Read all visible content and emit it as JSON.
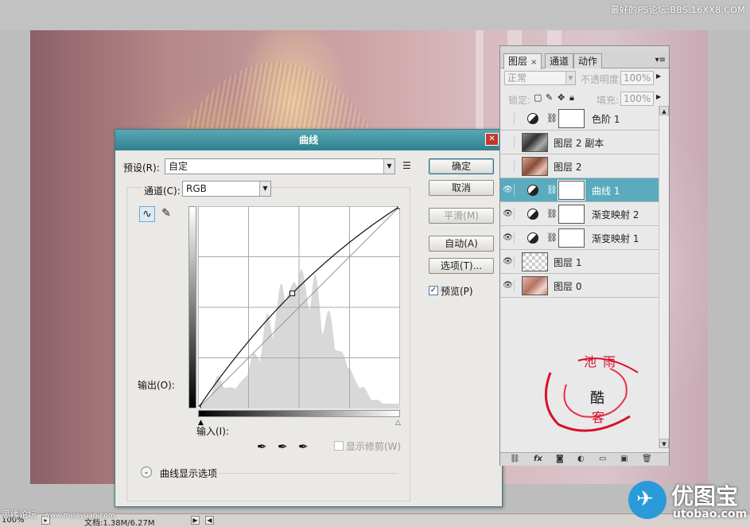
{
  "watermark_top": "最好的PS论坛:BBS.16XX8.COM",
  "watermark_bottom": "思缘论坛",
  "watermark_bottom_url": "www.missyuan.com",
  "statusbar": {
    "zoom": "100%",
    "doc": "文档:1.38M/6.27M"
  },
  "curves_dialog": {
    "title": "曲线",
    "preset_label": "预设(R):",
    "preset_value": "自定",
    "channel_label": "通道(C):",
    "channel_value": "RGB",
    "output_label": "输出(O):",
    "input_label": "输入(I):",
    "show_clipping_label": "显示修剪(W)",
    "display_options_label": "曲线显示选项",
    "buttons": {
      "ok": "确定",
      "cancel": "取消",
      "smooth": "平滑(M)",
      "auto": "自动(A)",
      "options": "选项(T)..."
    },
    "preview_label": "预览(P)",
    "preview_checked": true
  },
  "layers_panel": {
    "tabs": [
      "图层",
      "通道",
      "动作"
    ],
    "blend_mode": "正常",
    "opacity_label": "不透明度:",
    "opacity_value": "100%",
    "lock_label": "锁定:",
    "fill_label": "填充:",
    "fill_value": "100%",
    "layers": [
      {
        "name": "色阶 1",
        "visible": false,
        "type": "adjustment",
        "selected": false
      },
      {
        "name": "图层 2 副本",
        "visible": false,
        "type": "image",
        "selected": false
      },
      {
        "name": "图层 2",
        "visible": false,
        "type": "image",
        "selected": false
      },
      {
        "name": "曲线 1",
        "visible": true,
        "type": "adjustment",
        "selected": true
      },
      {
        "name": "渐变映射 2",
        "visible": true,
        "type": "adjustment",
        "selected": false
      },
      {
        "name": "渐变映射 1",
        "visible": true,
        "type": "adjustment",
        "selected": false
      },
      {
        "name": "图层 1",
        "visible": true,
        "type": "transparent",
        "selected": false
      },
      {
        "name": "图层 0",
        "visible": true,
        "type": "image",
        "selected": false
      }
    ]
  },
  "stamp_text": [
    "池",
    "雨",
    "酷",
    "客"
  ],
  "logo": {
    "cn": "优图宝",
    "en": "utobao.com"
  },
  "colors": {
    "dialog_title": "#2e8190",
    "selected_layer": "#5aabbd",
    "stamp": "#d8102a",
    "logo_blue": "#2a9bd8"
  },
  "chart_data": {
    "type": "line",
    "title": "",
    "xlabel": "输入(I):",
    "ylabel": "输出(O):",
    "xlim": [
      0,
      255
    ],
    "ylim": [
      0,
      255
    ],
    "grid": true,
    "series": [
      {
        "x": [
          0,
          119,
          255
        ],
        "y": [
          0,
          145,
          255
        ]
      },
      {
        "x": [
          0,
          255
        ],
        "y": [
          0,
          255
        ]
      }
    ]
  }
}
